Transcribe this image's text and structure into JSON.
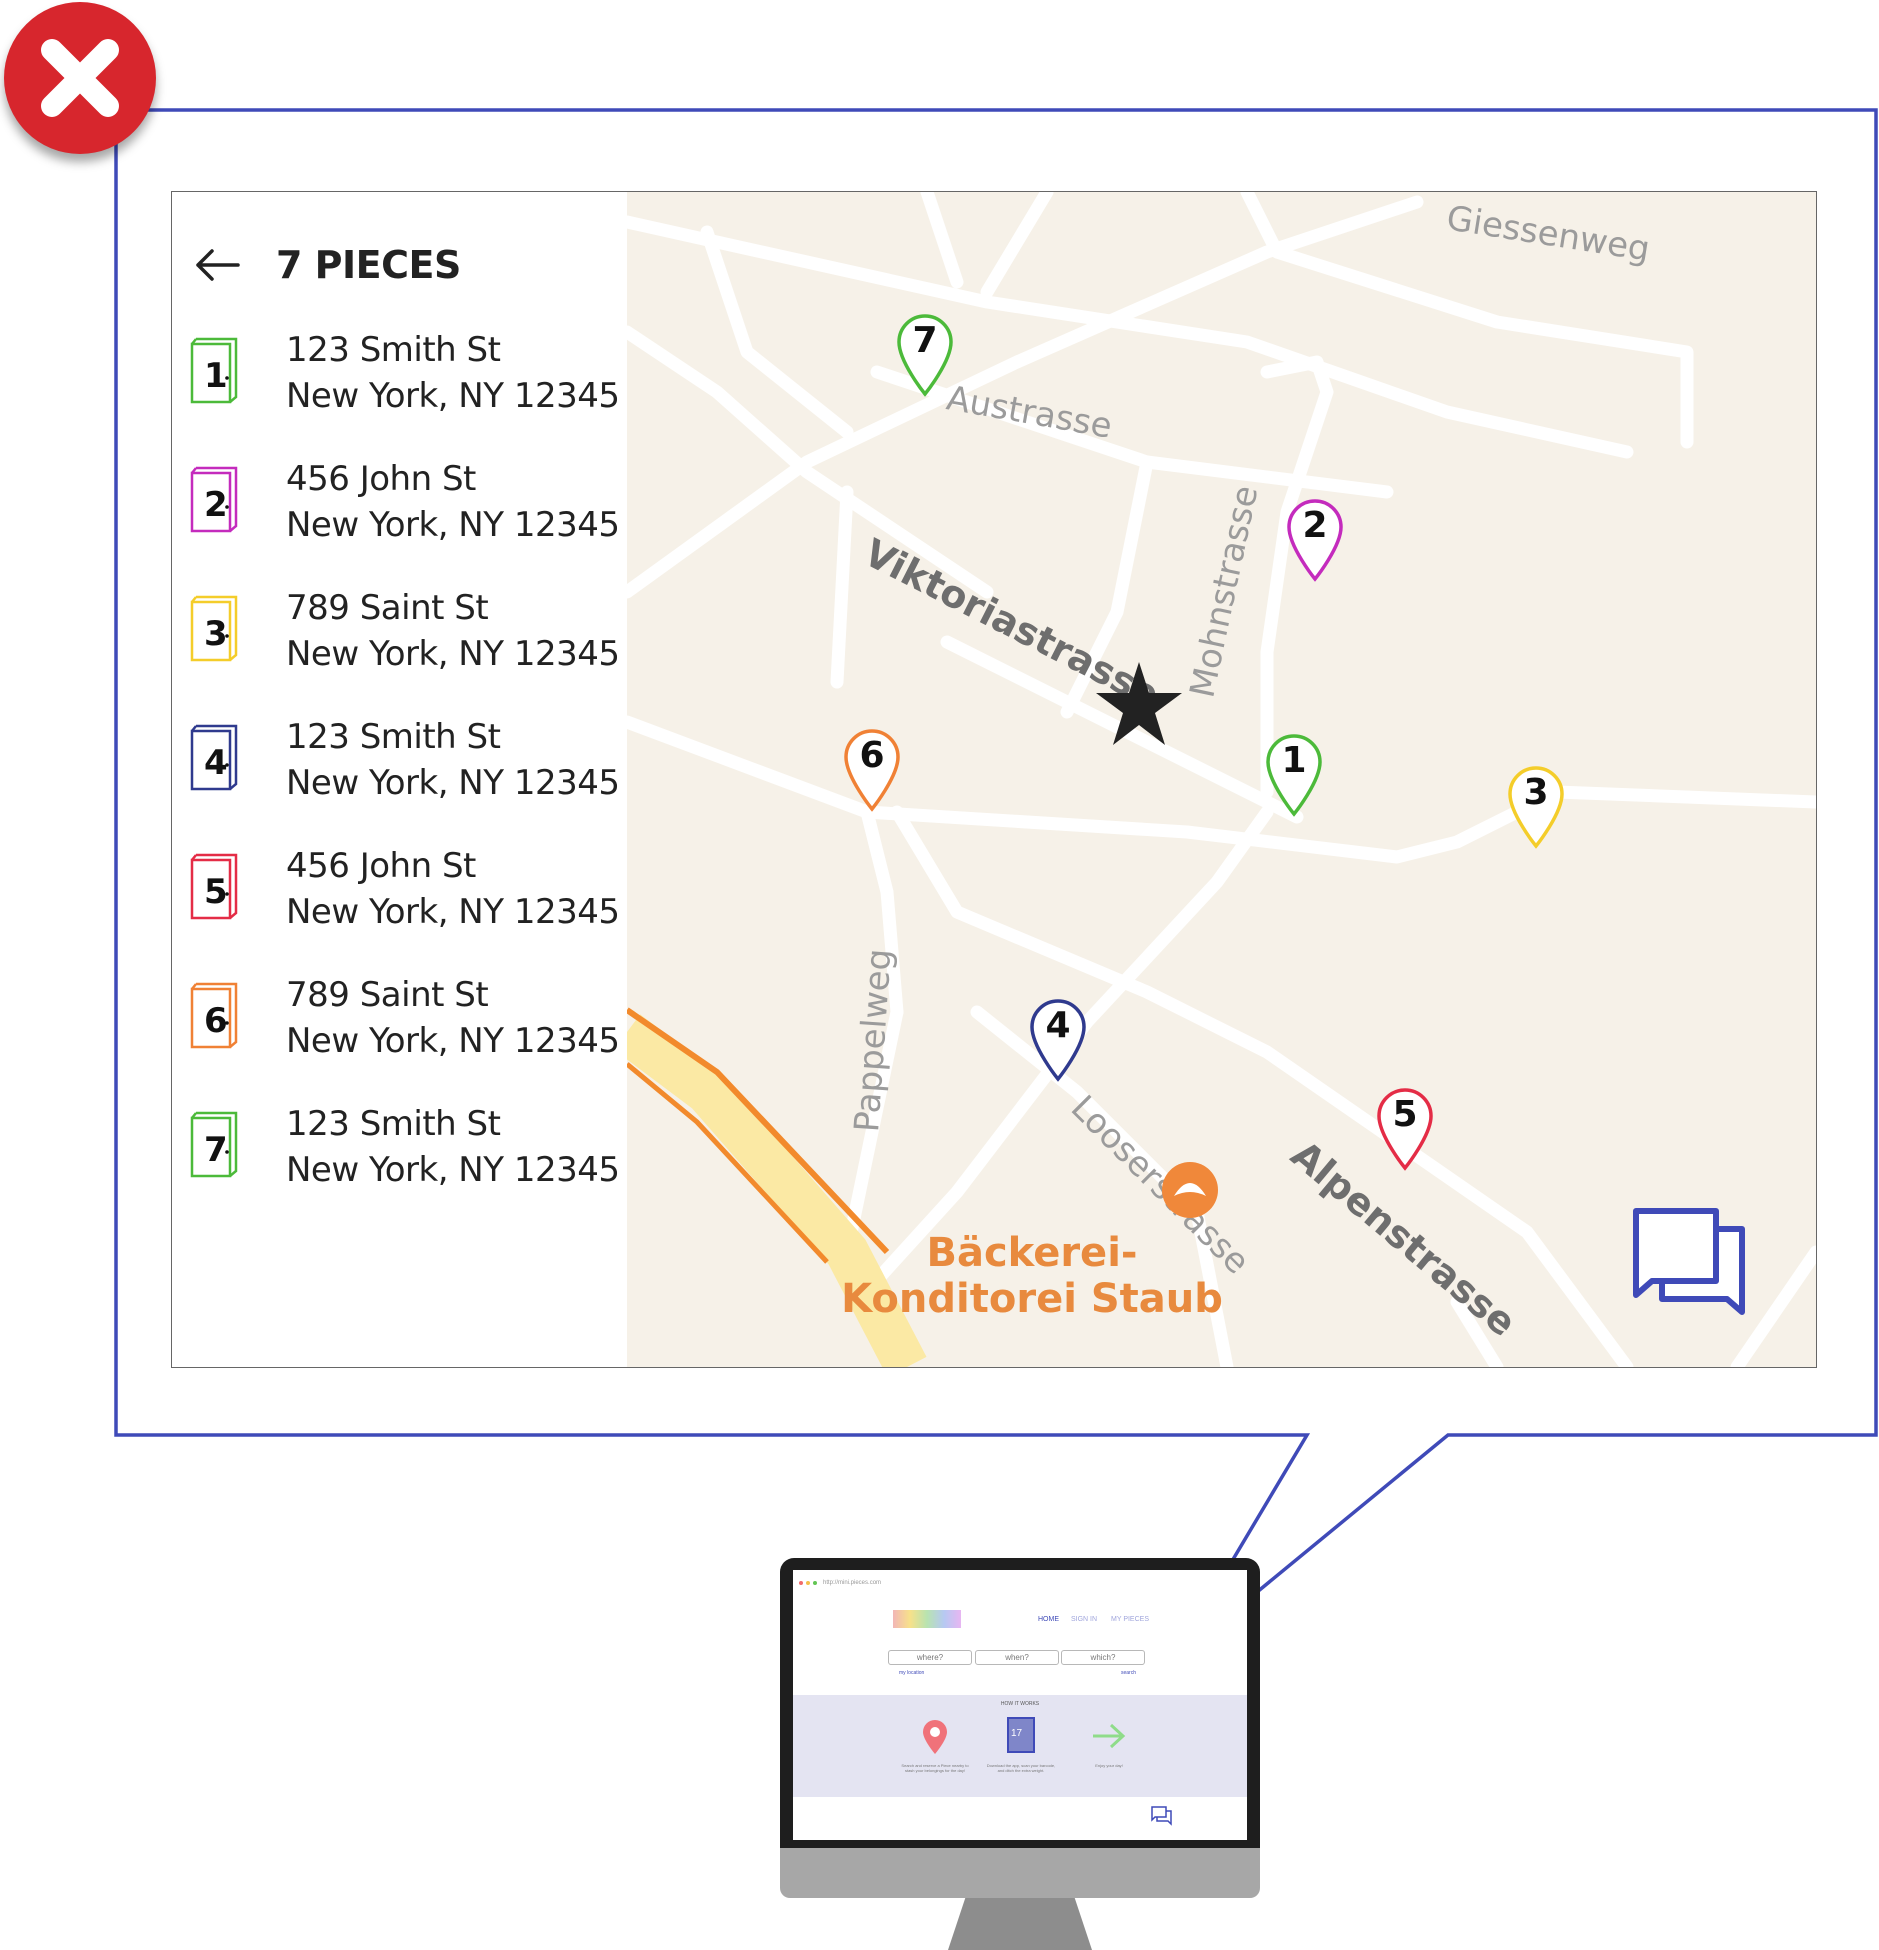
{
  "status": {
    "error_icon": "error-x-icon",
    "error_color": "#d7262d"
  },
  "panel": {
    "title": "7 PIECES",
    "back_icon": "arrow-left-icon",
    "pieces": [
      {
        "number": "1",
        "street": "123 Smith St",
        "city": "New York, NY 12345",
        "color": "#4cba3a"
      },
      {
        "number": "2",
        "street": "456 John St",
        "city": "New York, NY 12345",
        "color": "#c42bbd"
      },
      {
        "number": "3",
        "street": "789 Saint St",
        "city": "New York, NY 12345",
        "color": "#f4cd2a"
      },
      {
        "number": "4",
        "street": "123 Smith St",
        "city": "New York, NY 12345",
        "color": "#2f3a8e"
      },
      {
        "number": "5",
        "street": "456 John St",
        "city": "New York, NY 12345",
        "color": "#e42c46"
      },
      {
        "number": "6",
        "street": "789 Saint St",
        "city": "New York, NY 12345",
        "color": "#f08135"
      },
      {
        "number": "7",
        "street": "123 Smith St",
        "city": "New York, NY 12345",
        "color": "#4cba3a"
      }
    ]
  },
  "map": {
    "zoom_in_label": "+",
    "zoom_out_label": "−",
    "accent_color": "#3f4ab8",
    "streets": {
      "giessenweg": "Giessenweg",
      "austrasse": "Austrasse",
      "viktoriastrasse": "Viktoriastrasse",
      "mohnstrasse": "Mohnstrasse",
      "pappelweg": "Pappelweg",
      "looserstrasse": "Looserstrasse",
      "alpenstrasse": "Alpenstrasse"
    },
    "poi": {
      "line1": "Bäckerei-",
      "line2": "Konditorei Staub",
      "icon": "croissant-icon"
    },
    "center_marker": "star-icon",
    "chat_icon": "chat-bubbles-icon"
  },
  "monitor": {
    "url": "http://mini.pieces.com",
    "nav": {
      "home": "HOME",
      "sign_in": "SIGN IN",
      "my_pieces": "MY PIECES"
    },
    "search": {
      "where": "where?",
      "when": "when?",
      "which": "which?"
    },
    "my_location": "my location",
    "search_link": "search",
    "how_it_works": "HOW IT WORKS",
    "steps": [
      {
        "icon": "map-pin-icon",
        "text": "Search and reserve a Piece nearby to stash your belongings for the day!"
      },
      {
        "icon": "locker-icon",
        "label": "17",
        "text": "Download the app, scan your barcode, and ditch the extra weight."
      },
      {
        "icon": "arrow-right-icon",
        "text": "Enjoy your day!"
      }
    ]
  }
}
